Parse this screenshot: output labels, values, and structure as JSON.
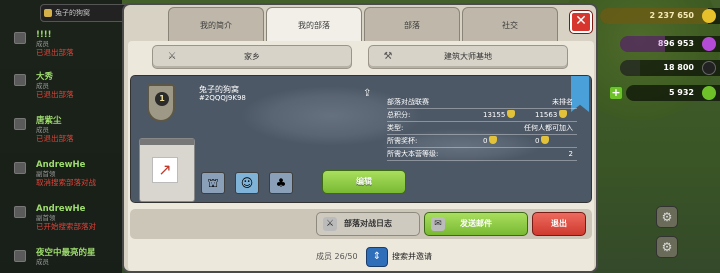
{
  "chat": {
    "filter_label": "兔子的狗窝",
    "messages": [
      {
        "name": "!!!!",
        "role": "成员",
        "text": "已退出部落"
      },
      {
        "name": "大秀",
        "role": "成员",
        "text": "已退出部落"
      },
      {
        "name": "唐紫尘",
        "role": "成员",
        "text": "已退出部落"
      },
      {
        "name": "AndrewHe",
        "role": "副首领",
        "text": "取消搜索部落对战"
      },
      {
        "name": "AndrewHe",
        "role": "副首领",
        "text": "已开始搜索部落对"
      },
      {
        "name": "夜空中最亮的星",
        "role": "成员",
        "text": ""
      }
    ]
  },
  "resources": [
    {
      "value": "2 237 650",
      "color": "#e7c12b",
      "fill": 0.9
    },
    {
      "value": "896 953",
      "color": "#b44bd6",
      "fill": 0.45
    },
    {
      "value": "18 800",
      "color": "#222222",
      "fill": 0.2
    },
    {
      "value": "5 932",
      "color": "#6fc12a",
      "fill": 0
    }
  ],
  "tabs": [
    "我的简介",
    "我的部落",
    "部落",
    "社交"
  ],
  "active_tab": 1,
  "subtabs": {
    "home": "家乡",
    "builder": "建筑大师基地"
  },
  "clan": {
    "level": "1",
    "name": "兔子的狗窝",
    "tag": "#2QQQJ9K98",
    "info": [
      {
        "label": "部落对战联赛",
        "value": "未排名"
      },
      {
        "label": "总积分:",
        "value_a": "13155",
        "value_b": "11563"
      },
      {
        "label": "类型:",
        "value": "任何人都可加入"
      },
      {
        "label": "所需奖杯:",
        "value_a": "0",
        "value_b": "0"
      },
      {
        "label": "所需大本营等级:",
        "value": "2"
      }
    ],
    "edit_label": "编辑"
  },
  "actions": {
    "war_log": "部落对战日志",
    "send_mail": "发送邮件",
    "leave": "退出"
  },
  "footer": {
    "members": "成员 26/50",
    "search": "搜索并邀请"
  }
}
